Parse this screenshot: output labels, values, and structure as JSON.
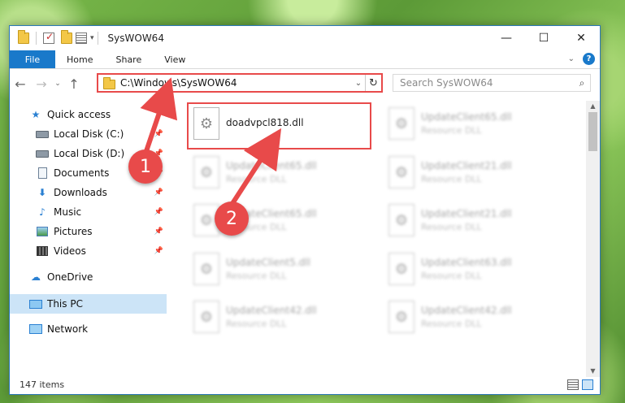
{
  "window": {
    "title": "SysWOW64",
    "minimize": "—",
    "maximize": "☐",
    "close": "✕"
  },
  "ribbon": {
    "tabs": [
      "File",
      "Home",
      "Share",
      "View"
    ],
    "collapse": "⌄",
    "help": "?"
  },
  "navbar": {
    "back": "←",
    "forward": "→",
    "recent": "⌄",
    "up": "↑",
    "address": "C:\\Windows\\SysWOW64",
    "address_drop": "⌄",
    "refresh": "↻",
    "search_placeholder": "Search SysWOW64",
    "search_icon": "⌕"
  },
  "sidebar": {
    "items": [
      {
        "label": "Quick access",
        "icon": "star-icon",
        "pinned": false
      },
      {
        "label": "Local Disk (C:)",
        "icon": "disk-icon",
        "pinned": true
      },
      {
        "label": "Local Disk (D:)",
        "icon": "disk-icon",
        "pinned": true
      },
      {
        "label": "Documents",
        "icon": "document-icon",
        "pinned": true
      },
      {
        "label": "Downloads",
        "icon": "download-icon",
        "pinned": true
      },
      {
        "label": "Music",
        "icon": "music-icon",
        "pinned": true
      },
      {
        "label": "Pictures",
        "icon": "pictures-icon",
        "pinned": true
      },
      {
        "label": "Videos",
        "icon": "videos-icon",
        "pinned": true
      },
      {
        "label": "OneDrive",
        "icon": "cloud-icon",
        "pinned": false
      },
      {
        "label": "This PC",
        "icon": "computer-icon",
        "pinned": false,
        "selected": true
      },
      {
        "label": "Network",
        "icon": "network-icon",
        "pinned": false
      }
    ],
    "pin_glyph": "📌"
  },
  "files": [
    {
      "name": "doadvpcl818.dll",
      "type": "",
      "blurred": false
    },
    {
      "name": "UpdateClient65.dll",
      "type": "Resource DLL",
      "blurred": true
    },
    {
      "name": "UpdateClient65.dll",
      "type": "Resource DLL",
      "blurred": true
    },
    {
      "name": "UpdateClient21.dll",
      "type": "Resource DLL",
      "blurred": true
    },
    {
      "name": "UpdateClient65.dll",
      "type": "Resource DLL",
      "blurred": true
    },
    {
      "name": "UpdateClient21.dll",
      "type": "Resource DLL",
      "blurred": true
    },
    {
      "name": "UpdateClient5.dll",
      "type": "Resource DLL",
      "blurred": true
    },
    {
      "name": "UpdateClient63.dll",
      "type": "Resource DLL",
      "blurred": true
    },
    {
      "name": "UpdateClient42.dll",
      "type": "Resource DLL",
      "blurred": true
    },
    {
      "name": "UpdateClient42.dll",
      "type": "Resource DLL",
      "blurred": true
    }
  ],
  "status": {
    "item_count": "147 items"
  },
  "callouts": [
    "1",
    "2"
  ],
  "colors": {
    "accent": "#1979ca",
    "highlight": "#e84a4a",
    "selected": "#cce4f7"
  }
}
